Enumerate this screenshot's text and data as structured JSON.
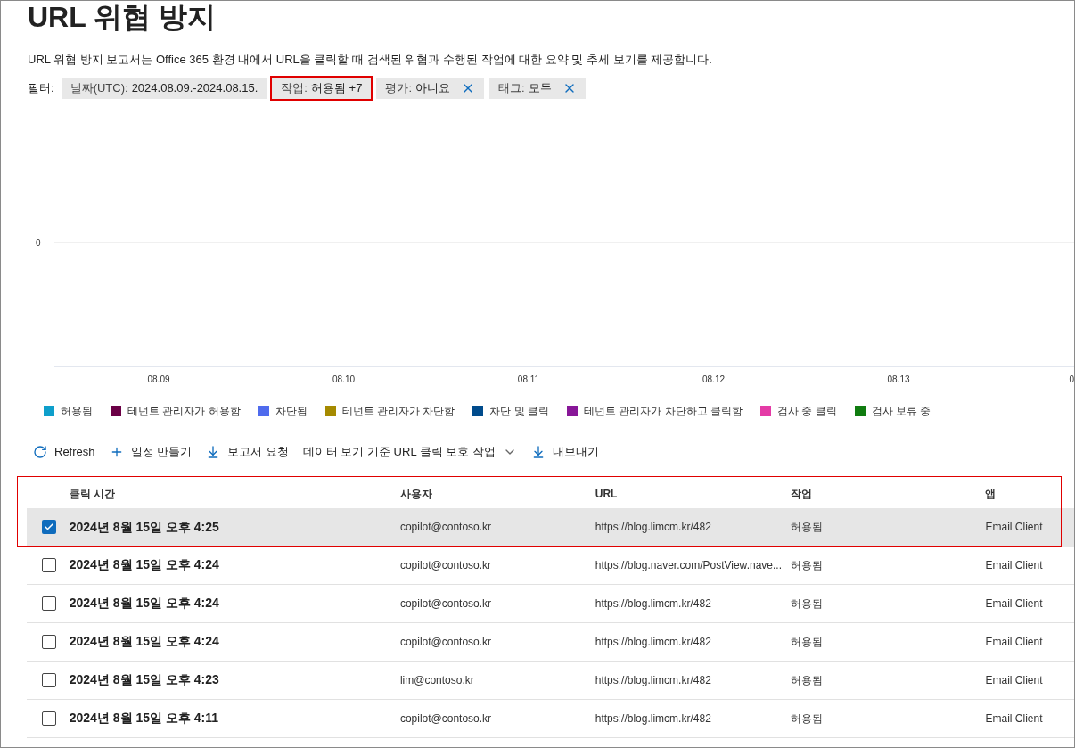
{
  "title": "URL 위협 방지",
  "description": "URL 위협 방지 보고서는 Office 365 환경 내에서 URL을 클릭할 때 검색된 위협과 수행된 작업에 대한 요약 및 추세 보기를 제공합니다.",
  "filters": {
    "label": "필터:",
    "chips": [
      {
        "name": "날짜(UTC):",
        "value": "2024.08.09.-2024.08.15.",
        "removable": false,
        "highlighted": false
      },
      {
        "name": "작업:",
        "value": "허용됨 +7",
        "removable": false,
        "highlighted": true
      },
      {
        "name": "평가:",
        "value": "아니요",
        "removable": true,
        "highlighted": false
      },
      {
        "name": "태그:",
        "value": "모두",
        "removable": true,
        "highlighted": false
      }
    ]
  },
  "chart": {
    "y_label": "0",
    "x_labels": [
      "08.09",
      "08.10",
      "08.11",
      "08.12",
      "08.13",
      "0"
    ],
    "legend": [
      {
        "name": "허용됨",
        "color": "#0e9fcb"
      },
      {
        "name": "테넌트 관리자가 허용함",
        "color": "#6b0046"
      },
      {
        "name": "차단됨",
        "color": "#4f6bed"
      },
      {
        "name": "테넌트 관리자가 차단함",
        "color": "#a58a00"
      },
      {
        "name": "차단 및 클릭",
        "color": "#004b8c"
      },
      {
        "name": "테넌트 관리자가 차단하고 클릭함",
        "color": "#881798"
      },
      {
        "name": "검사 중 클릭",
        "color": "#e43ba6"
      },
      {
        "name": "검사 보류 중",
        "color": "#107c10"
      }
    ]
  },
  "toolbar": [
    {
      "kind": "refresh",
      "label": "Refresh"
    },
    {
      "kind": "add",
      "label": "일정 만들기"
    },
    {
      "kind": "download",
      "label": "보고서 요청"
    },
    {
      "kind": "dropdown",
      "label": "데이터 보기 기준 URL 클릭 보호 작업"
    },
    {
      "kind": "download",
      "label": "내보내기"
    }
  ],
  "table": {
    "highlighted": true,
    "columns": [
      "클릭 시간",
      "사용자",
      "URL",
      "작업",
      "앱"
    ],
    "rows": [
      {
        "checked": true,
        "cells": [
          "2024년 8월 15일 오후 4:25",
          "copilot@contoso.kr",
          "https://blog.limcm.kr/482",
          "허용됨",
          "Email Client"
        ]
      },
      {
        "checked": false,
        "cells": [
          "2024년 8월 15일 오후 4:24",
          "copilot@contoso.kr",
          "https://blog.naver.com/PostView.nave...",
          "허용됨",
          "Email Client"
        ]
      },
      {
        "checked": false,
        "cells": [
          "2024년 8월 15일 오후 4:24",
          "copilot@contoso.kr",
          "https://blog.limcm.kr/482",
          "허용됨",
          "Email Client"
        ]
      },
      {
        "checked": false,
        "cells": [
          "2024년 8월 15일 오후 4:24",
          "copilot@contoso.kr",
          "https://blog.limcm.kr/482",
          "허용됨",
          "Email Client"
        ]
      },
      {
        "checked": false,
        "cells": [
          "2024년 8월 15일 오후 4:23",
          "lim@contoso.kr",
          "https://blog.limcm.kr/482",
          "허용됨",
          "Email Client"
        ]
      },
      {
        "checked": false,
        "cells": [
          "2024년 8월 15일 오후 4:11",
          "copilot@contoso.kr",
          "https://blog.limcm.kr/482",
          "허용됨",
          "Email Client"
        ]
      }
    ]
  }
}
